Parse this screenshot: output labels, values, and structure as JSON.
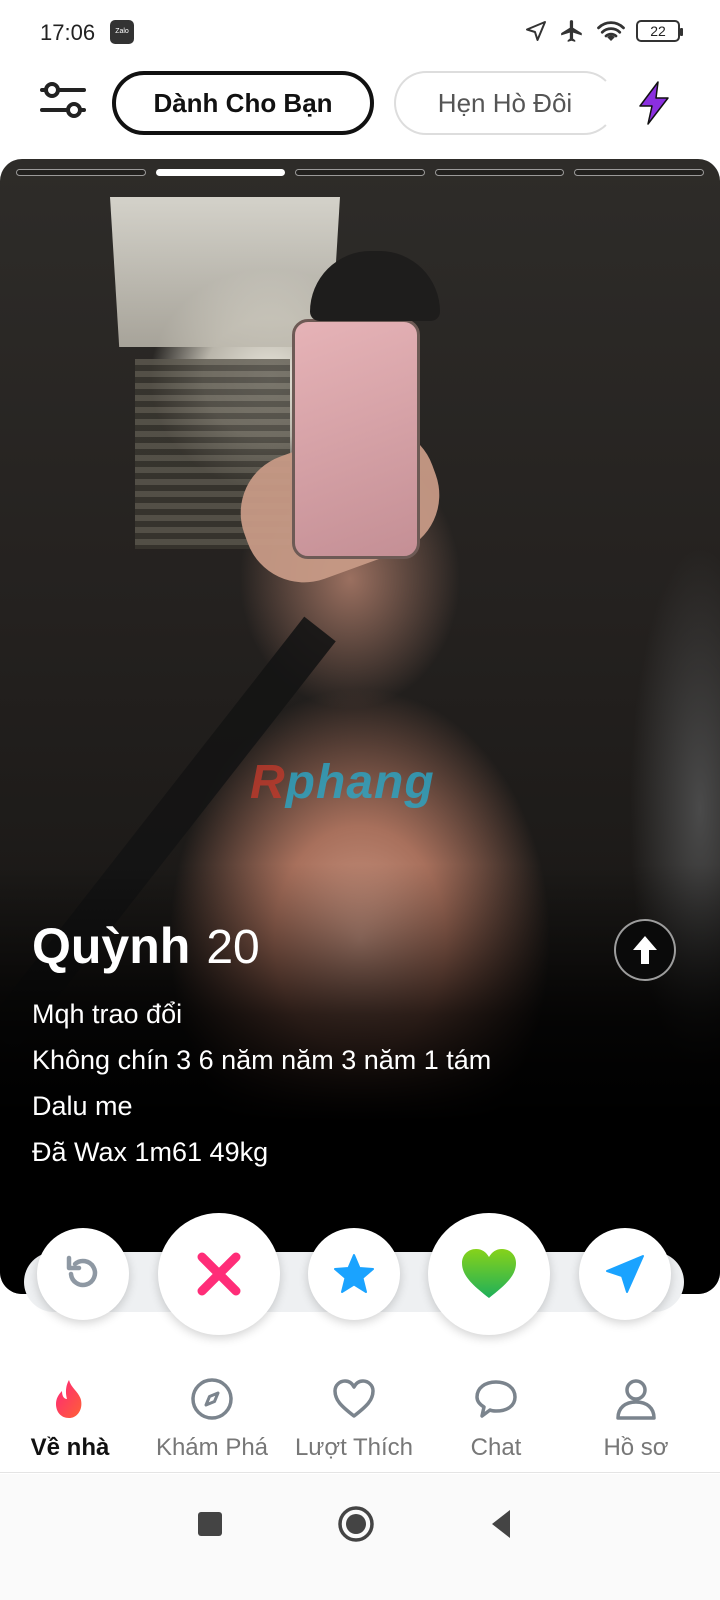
{
  "status_bar": {
    "time": "17:06",
    "zalo_label": "Zalo",
    "battery": "22",
    "icons": [
      "location-icon",
      "airplane-icon",
      "wifi-icon",
      "battery-icon"
    ]
  },
  "header": {
    "filter_icon": "sliders-icon",
    "tabs": [
      {
        "label": "Dành Cho Bạn",
        "active": true
      },
      {
        "label": "Hẹn Hò Đôi",
        "active": false
      }
    ],
    "boost_icon": "bolt-icon",
    "boost_color": "#8b2fe0"
  },
  "card": {
    "photo_count": 5,
    "current_photo": 2,
    "watermark": {
      "part1": "R",
      "part2": "phang"
    },
    "name": "Quỳnh",
    "age": "20",
    "bio": [
      "Mqh trao đổi",
      "Không chín 3 6 năm năm 3 năm 1 tám",
      "Dalu me",
      "Đã Wax 1m61 49kg"
    ]
  },
  "actions": [
    {
      "name": "rewind",
      "icon": "rewind-icon",
      "color": "#8e98a3"
    },
    {
      "name": "nope",
      "icon": "x-icon",
      "color": "#ff2d78"
    },
    {
      "name": "super-like",
      "icon": "star-icon",
      "color": "#1aa3ff"
    },
    {
      "name": "like",
      "icon": "heart-icon",
      "color": "#3fc21e"
    },
    {
      "name": "send",
      "icon": "send-icon",
      "color": "#1aa3ff"
    }
  ],
  "bottom_nav": {
    "items": [
      {
        "label": "Về nhà",
        "icon": "flame-icon",
        "active": true
      },
      {
        "label": "Khám Phá",
        "icon": "compass-icon",
        "active": false
      },
      {
        "label": "Lượt Thích",
        "icon": "heart-outline-icon",
        "active": false
      },
      {
        "label": "Chat",
        "icon": "chat-bubble-icon",
        "active": false
      },
      {
        "label": "Hồ sơ",
        "icon": "profile-icon",
        "active": false
      }
    ],
    "active_color": "#fd4a5f"
  }
}
